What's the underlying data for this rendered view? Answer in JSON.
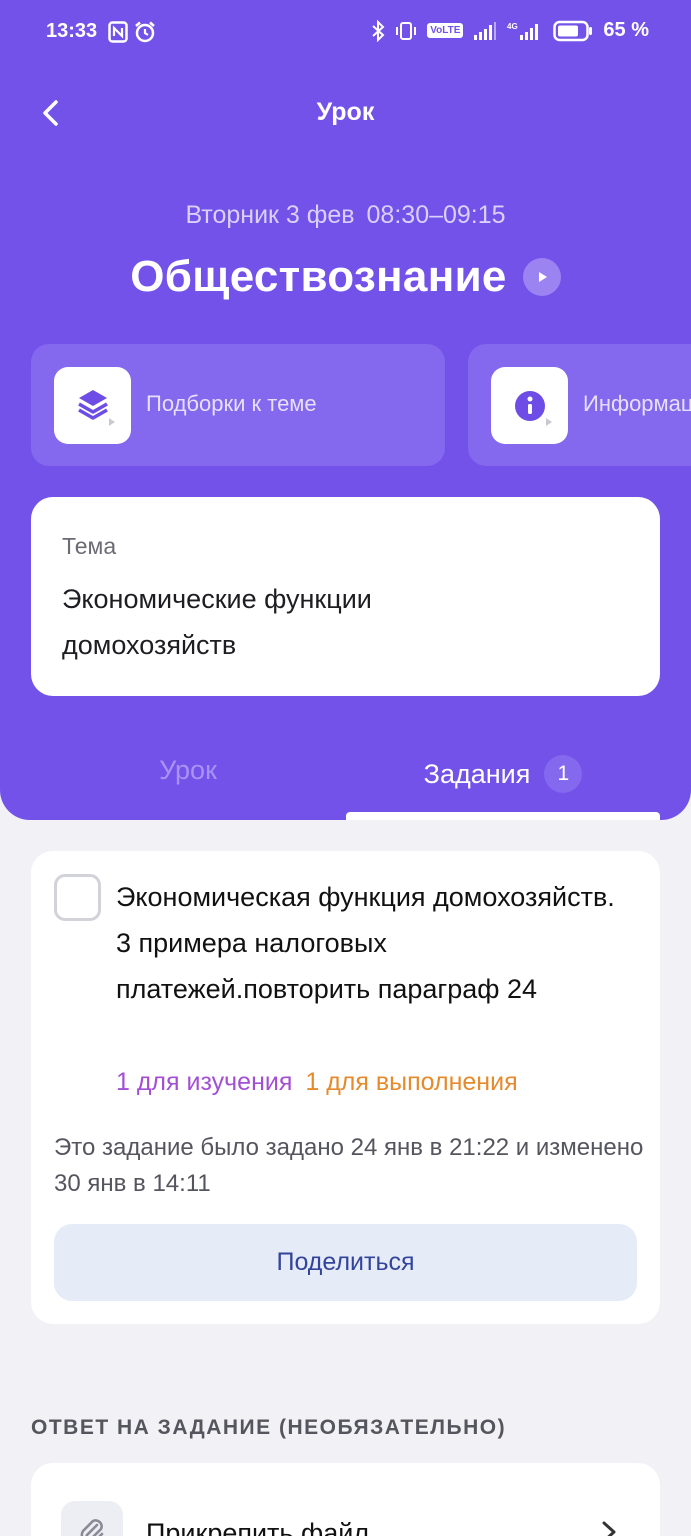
{
  "status_bar": {
    "time": "13:33",
    "battery_percent": "65 %",
    "left_icons": [
      "nfc-icon",
      "alarm-icon"
    ],
    "right_icons": [
      "bluetooth-icon",
      "vibrate-icon",
      "volte-icon",
      "signal-icon",
      "4g-signal-icon",
      "battery-icon"
    ],
    "volte_label": "VoLTE"
  },
  "nav": {
    "title": "Урок",
    "back_icon": "chevron-left-icon"
  },
  "lesson": {
    "day": "Вторник 3 фев",
    "time_range": "08:30–09:15",
    "subject": "Обществознание"
  },
  "actions": [
    {
      "label": "Подборки к теме",
      "icon": "layers-icon"
    },
    {
      "label": "Информация",
      "icon": "info-icon"
    }
  ],
  "topic": {
    "label": "Тема",
    "text": "Экономические функции домохозяйств"
  },
  "tabs": {
    "lesson_label": "Урок",
    "tasks_label": "Задания",
    "tasks_count": "1",
    "active": "tasks"
  },
  "task": {
    "title": "Экономическая функция домохозяйств. 3 примера налоговых платежей.повторить параграф 24",
    "study_label": "1 для изучения",
    "do_label": "1 для выполнения",
    "info": "Это задание было задано 24 янв в 21:22 и изменено 30 янв в 14:11",
    "share_label": "Поделиться",
    "checked": false
  },
  "answer": {
    "heading": "ОТВЕТ НА ЗАДАНИЕ (НЕОБЯЗАТЕЛЬНО)",
    "attach_label": "Прикрепить файл"
  },
  "colors": {
    "header_purple": "#7352ea",
    "card_purple": "#8468ee",
    "study_purple": "#a34fd4",
    "do_orange": "#e58a2d",
    "share_text": "#33459a",
    "share_bg": "#e6ebf8",
    "page_bg": "#f1f1f6"
  }
}
